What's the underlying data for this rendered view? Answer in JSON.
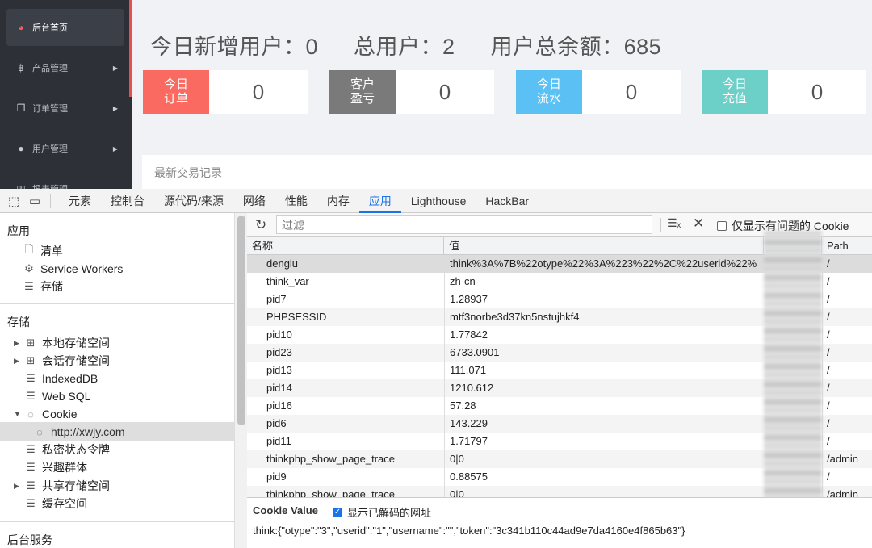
{
  "webpage": {
    "sidebar": [
      {
        "label": "后台首页",
        "icon": "dashboard-icon",
        "active": true
      },
      {
        "label": "产品管理",
        "icon": "bitcoin-icon",
        "active": false
      },
      {
        "label": "订单管理",
        "icon": "copy-icon",
        "active": false
      },
      {
        "label": "用户管理",
        "icon": "user-icon",
        "active": false
      },
      {
        "label": "报表管理",
        "icon": "chart-icon",
        "active": false
      }
    ],
    "stats": {
      "new_users": "今日新增用户：0",
      "total_users": "总用户：2",
      "total_balance": "用户总余额：685"
    },
    "cards": [
      {
        "label_line1": "今日",
        "label_line2": "订单",
        "value": "0",
        "color": "#fa6a60"
      },
      {
        "label_line1": "客户",
        "label_line2": "盈亏",
        "value": "0",
        "color": "#7a7a7a"
      },
      {
        "label_line1": "今日",
        "label_line2": "流水",
        "value": "0",
        "color": "#5bc1f5"
      },
      {
        "label_line1": "今日",
        "label_line2": "充值",
        "value": "0",
        "color": "#6ccfc8"
      }
    ],
    "recent_title": "最新交易记录"
  },
  "devtools": {
    "tabs": [
      "元素",
      "控制台",
      "源代码/来源",
      "网络",
      "性能",
      "内存",
      "应用",
      "Lighthouse",
      "HackBar"
    ],
    "active_tab": "应用",
    "left": {
      "app_header": "应用",
      "app_items": [
        {
          "label": "清单",
          "icon": "file-icon"
        },
        {
          "label": "Service Workers",
          "icon": "gears-icon"
        },
        {
          "label": "存储",
          "icon": "database-icon"
        }
      ],
      "storage_header": "存储",
      "storage_items": [
        {
          "label": "本地存储空间",
          "icon": "grid-icon",
          "toggle": "▶"
        },
        {
          "label": "会话存储空间",
          "icon": "grid-icon",
          "toggle": "▶"
        },
        {
          "label": "IndexedDB",
          "icon": "database-icon",
          "toggle": ""
        },
        {
          "label": "Web SQL",
          "icon": "database-icon",
          "toggle": ""
        },
        {
          "label": "Cookie",
          "icon": "cookie-icon",
          "toggle": "▼"
        },
        {
          "label": "http://xwjy.com",
          "icon": "cookie-icon",
          "toggle": ""
        },
        {
          "label": "私密状态令牌",
          "icon": "database-icon",
          "toggle": ""
        },
        {
          "label": "兴趣群体",
          "icon": "database-icon",
          "toggle": ""
        },
        {
          "label": "共享存储空间",
          "icon": "database-icon",
          "toggle": "▶"
        },
        {
          "label": "缓存空间",
          "icon": "database-icon",
          "toggle": ""
        }
      ],
      "backend_header": "后台服务"
    },
    "right": {
      "filter_placeholder": "过滤",
      "only_issues_label": "仅显示有问题的 Cookie",
      "columns": {
        "name": "名称",
        "value": "值",
        "path": "Path"
      },
      "rows": [
        {
          "name": "denglu",
          "value": "think%3A%7B%22otype%22%3A%223%22%2C%22userid%22%",
          "path": "/"
        },
        {
          "name": "think_var",
          "value": "zh-cn",
          "path": "/"
        },
        {
          "name": "pid7",
          "value": "1.28937",
          "path": "/"
        },
        {
          "name": "PHPSESSID",
          "value": "mtf3norbe3d37kn5nstujhkf4",
          "path": "/"
        },
        {
          "name": "pid10",
          "value": "1.77842",
          "path": "/"
        },
        {
          "name": "pid23",
          "value": "6733.0901",
          "path": "/"
        },
        {
          "name": "pid13",
          "value": "111.071",
          "path": "/"
        },
        {
          "name": "pid14",
          "value": "1210.612",
          "path": "/"
        },
        {
          "name": "pid16",
          "value": "57.28",
          "path": "/"
        },
        {
          "name": "pid6",
          "value": "143.229",
          "path": "/"
        },
        {
          "name": "pid11",
          "value": "1.71797",
          "path": "/"
        },
        {
          "name": "thinkphp_show_page_trace",
          "value": "0|0",
          "path": "/admin"
        },
        {
          "name": "pid9",
          "value": "0.88575",
          "path": "/"
        },
        {
          "name": "thinkphp_show_page_trace",
          "value": "0|0",
          "path": "/admin"
        }
      ],
      "cookie_value_title": "Cookie Value",
      "show_decoded_label": "显示已解码的网址",
      "cookie_value_text": "think:{\"otype\":\"3\",\"userid\":\"1\",\"username\":\"\",\"token\":\"3c341b110c44ad9e7da4160e4f865b63\"}"
    }
  }
}
